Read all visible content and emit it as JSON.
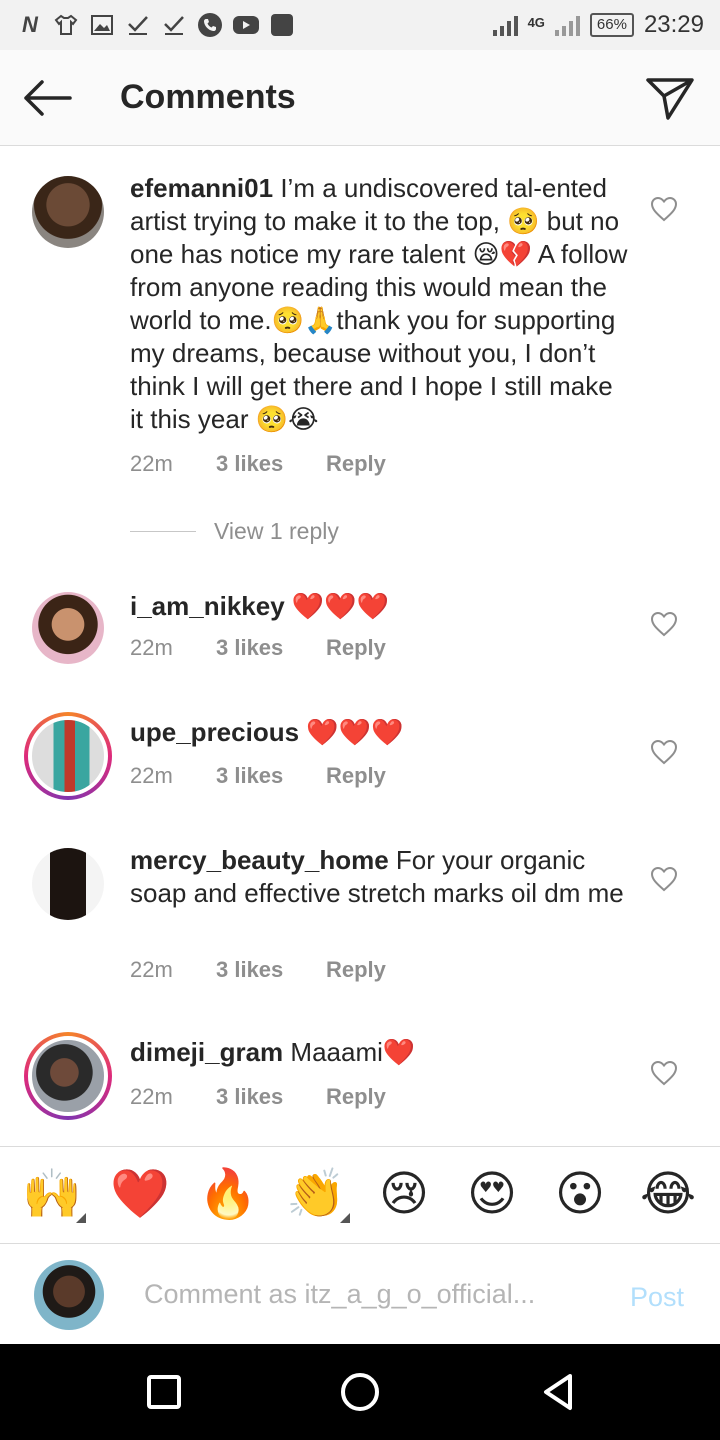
{
  "status_bar": {
    "time": "23:29",
    "battery": "66%",
    "network": "4G",
    "left_icons": [
      "N",
      "shirt-icon",
      "image-icon",
      "check-icon",
      "check-icon",
      "phone-icon",
      "youtube-icon",
      "app-icon"
    ]
  },
  "header": {
    "title": "Comments"
  },
  "comments": [
    {
      "username": "efemanni01",
      "text": "I’m a undiscovered tal-ented artist trying to make it to the top, 🥺 but no one has notice my rare talent 😪💔 A follow from anyone reading this would mean the world to me.🥺🙏thank you for supporting my dreams, because without you, I don’t think I will get there and I hope I still make it this year 🥺😭",
      "time": "22m",
      "likes": "3 likes",
      "reply": "Reply",
      "view_replies": "View 1 reply"
    },
    {
      "username": "i_am_nikkey",
      "text": "❤️❤️❤️",
      "time": "22m",
      "likes": "3 likes",
      "reply": "Reply"
    },
    {
      "username": "upe_precious",
      "text": "❤️❤️❤️",
      "time": "22m",
      "likes": "3 likes",
      "reply": "Reply"
    },
    {
      "username": "mercy_beauty_home",
      "text": "For your organic soap and effective stretch marks oil dm me",
      "time": "22m",
      "likes": "3 likes",
      "reply": "Reply"
    },
    {
      "username": "dimeji_gram",
      "text": "Maaami❤️",
      "time": "22m",
      "likes": "3 likes",
      "reply": "Reply"
    }
  ],
  "emoji_bar": [
    "🙌",
    "❤️",
    "🔥",
    "👏",
    "😢",
    "😍",
    "😮",
    "😂"
  ],
  "composer": {
    "placeholder": "Comment as itz_a_g_o_official...",
    "post_label": "Post"
  },
  "colors": {
    "accent_disabled": "#b2dffc",
    "secondary_text": "#8e8e8e",
    "primary_text": "#262626"
  }
}
